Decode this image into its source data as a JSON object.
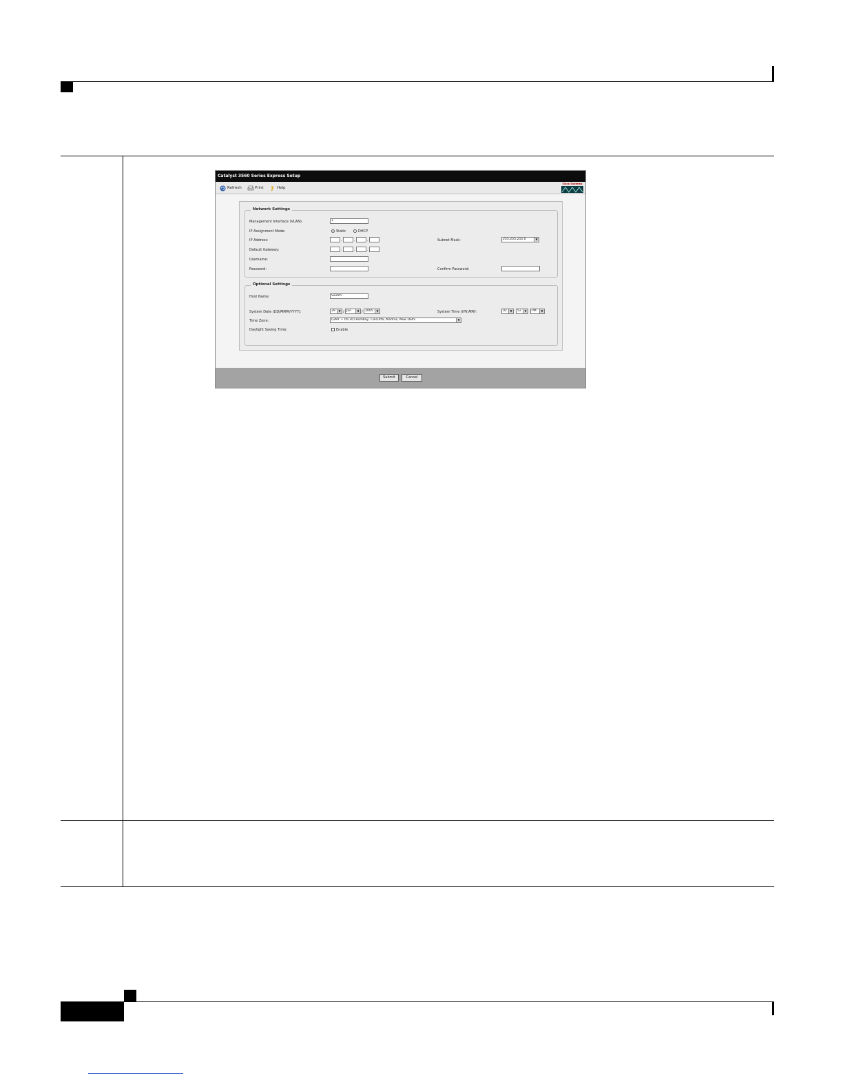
{
  "window": {
    "title": "Catalyst 3560 Series Express Setup"
  },
  "toolbar": {
    "refresh_label": "Refresh",
    "print_label": "Print",
    "help_label": "Help",
    "logo_text": "Cisco Systems"
  },
  "network_settings": {
    "legend": "Network Settings",
    "mgmt_interface_label": "Management Interface (VLAN):",
    "mgmt_interface_value": "1",
    "ip_mode_label": "IP Assignment Mode:",
    "ip_mode_static": "Static",
    "ip_mode_dhcp": "DHCP",
    "ip_mode_selected": "Static",
    "ip_address_label": "IP Address:",
    "subnet_mask_label": "Subnet Mask:",
    "subnet_mask_value": "255.255.255.0",
    "default_gateway_label": "Default Gateway:",
    "username_label": "Username:",
    "password_label": "Password:",
    "confirm_password_label": "Confirm Password:"
  },
  "optional_settings": {
    "legend": "Optional Settings",
    "host_name_label": "Host Name:",
    "host_name_value": "Switch",
    "system_date_label": "System Date",
    "system_date_format": "(DD/MMM/YYYY):",
    "date_day": "29",
    "date_month": "Jun",
    "date_year": "2005",
    "system_time_label": "System Time",
    "system_time_format": "(HH:MM):",
    "time_hour": "02",
    "time_minute": "52",
    "time_ampm": "PM",
    "time_zone_label": "Time Zone:",
    "time_zone_value": "(GMT + 05:30) Bombay, Calcutta, Madras, New Delhi",
    "dst_label": "Daylight Saving Time:",
    "dst_enable_label": "Enable"
  },
  "actions": {
    "submit_label": "Submit",
    "cancel_label": "Cancel"
  },
  "colors": {
    "titlebar": "#0c0c0c",
    "footerbar": "#a3a3a3",
    "panel": "#ececec"
  }
}
